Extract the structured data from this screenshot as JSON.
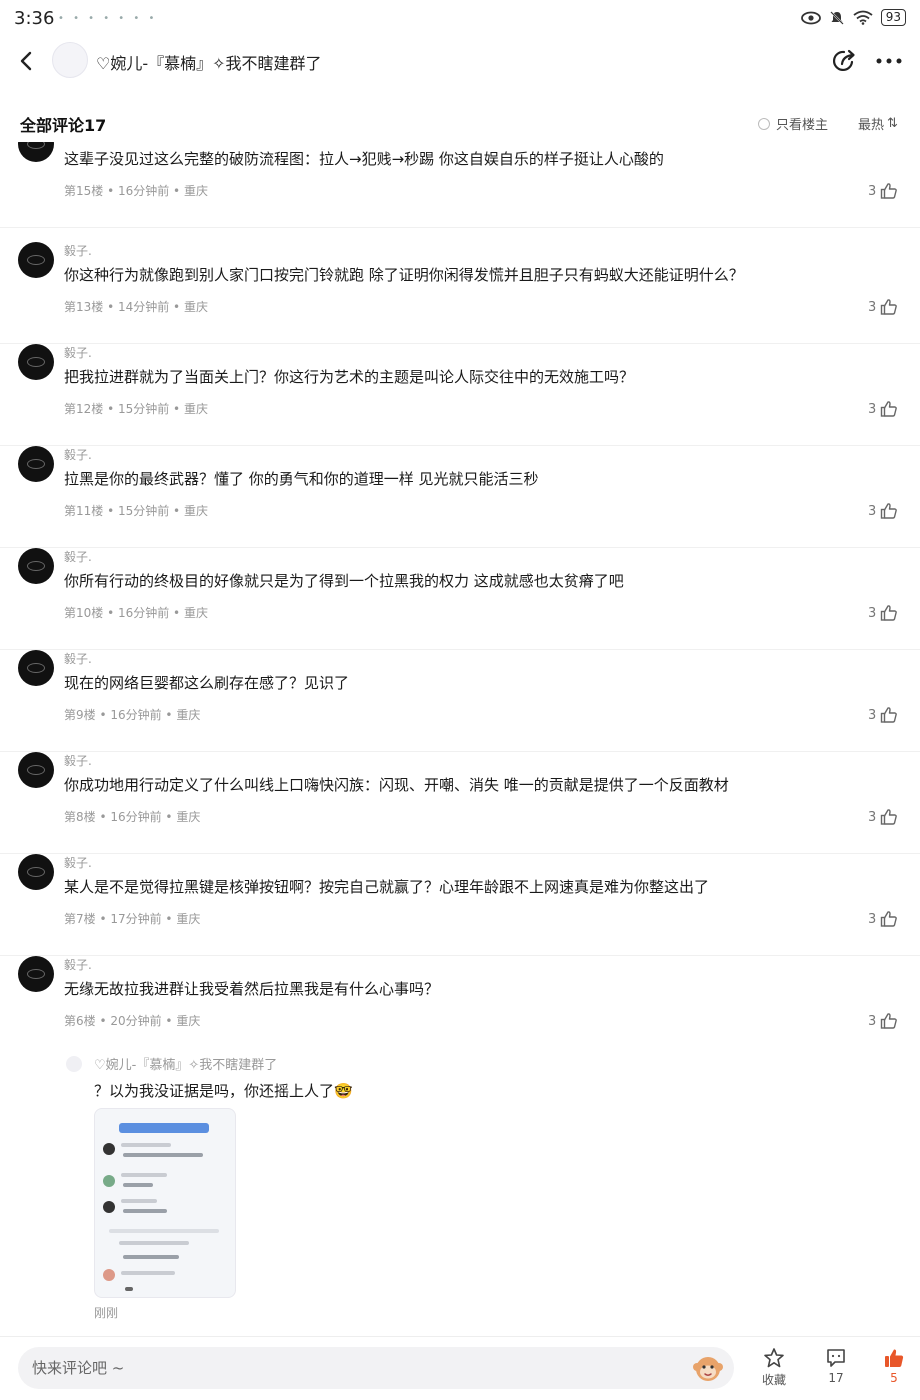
{
  "status_bar": {
    "time": "3:36",
    "notification_icons": "• • • • • • •",
    "battery": "93"
  },
  "header": {
    "title": "♡婉儿-『慕楠』✧我不瞎建群了"
  },
  "filter_bar": {
    "heading": "全部评论17",
    "owner_only": "只看楼主",
    "sort": "最热",
    "sort_icon": "⇅"
  },
  "comments": [
    {
      "user": "",
      "text": "这辈子没见过这么完整的破防流程图：拉人→犯贱→秒踢 你这自娱自乐的样子挺让人心酸的",
      "meta": "第15楼 • 16分钟前 • 重庆",
      "likes": "3"
    },
    {
      "user": "毅子.",
      "text": "你这种行为就像跑到别人家门口按完门铃就跑 除了证明你闲得发慌并且胆子只有蚂蚁大还能证明什么？",
      "meta": "第13楼 • 14分钟前 • 重庆",
      "likes": "3"
    },
    {
      "user": "毅子.",
      "text": "把我拉进群就为了当面关上门？你这行为艺术的主题是叫论人际交往中的无效施工吗？",
      "meta": "第12楼 • 15分钟前 • 重庆",
      "likes": "3"
    },
    {
      "user": "毅子.",
      "text": "拉黑是你的最终武器？懂了 你的勇气和你的道理一样 见光就只能活三秒",
      "meta": "第11楼 • 15分钟前 • 重庆",
      "likes": "3"
    },
    {
      "user": "毅子.",
      "text": "你所有行动的终极目的好像就只是为了得到一个拉黑我的权力 这成就感也太贫瘠了吧",
      "meta": "第10楼 • 16分钟前 • 重庆",
      "likes": "3"
    },
    {
      "user": "毅子.",
      "text": "现在的网络巨婴都这么刷存在感了？见识了",
      "meta": "第9楼 • 16分钟前 • 重庆",
      "likes": "3"
    },
    {
      "user": "毅子.",
      "text": "你成功地用行动定义了什么叫线上口嗨快闪族：闪现、开嘲、消失 唯一的贡献是提供了一个反面教材",
      "meta": "第8楼 • 16分钟前 • 重庆",
      "likes": "3"
    },
    {
      "user": "毅子.",
      "text": "某人是不是觉得拉黑键是核弹按钮啊？按完自己就赢了？心理年龄跟不上网速真是难为你整这出了",
      "meta": "第7楼 • 17分钟前 • 重庆",
      "likes": "3"
    },
    {
      "user": "毅子.",
      "text": "无缘无故拉我进群让我受着然后拉黑我是有什么心事吗？",
      "meta": "第6楼 • 20分钟前 • 重庆",
      "likes": "3"
    }
  ],
  "reply": {
    "user": "♡婉儿-『慕楠』✧我不瞎建群了",
    "text": "？以为我没证据是吗，你还摇上人了🤓",
    "time": "刚刚"
  },
  "bottom_bar": {
    "input_placeholder": "快来评论吧 ~",
    "favorite_label": "收藏",
    "comment_count": "17",
    "like_count": "5"
  },
  "icons": {
    "back": "chevron-left",
    "share": "share-arrow",
    "more": "ellipsis",
    "like": "thumbs-up",
    "favorite": "star",
    "comment": "chat-bubble",
    "emoji": "monkey-face"
  },
  "colors": {
    "accent_like": "#e8572a",
    "text_primary": "#1a1a1a",
    "text_secondary": "#999999"
  }
}
